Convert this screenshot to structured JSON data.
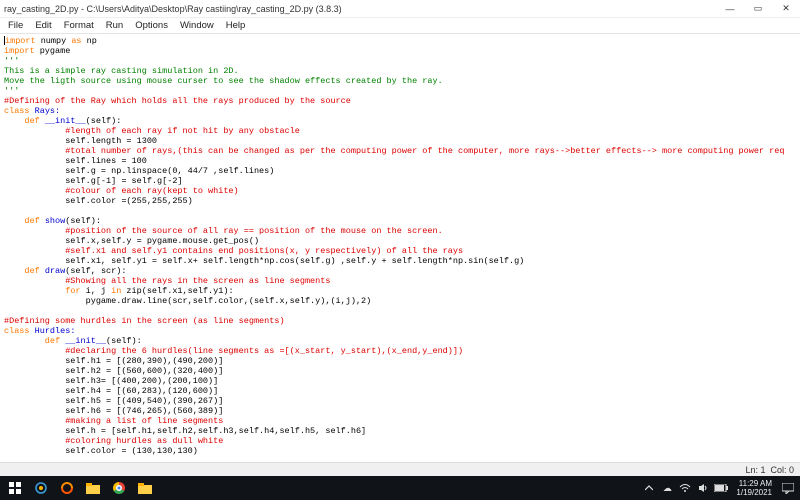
{
  "title": "ray_casting_2D.py - C:\\Users\\Aditya\\Desktop\\Ray castiing\\ray_casting_2D.py (3.8.3)",
  "menus": {
    "file": "File",
    "edit": "Edit",
    "format": "Format",
    "run": "Run",
    "options": "Options",
    "window": "Window",
    "help": "Help"
  },
  "status": {
    "ln": "Ln: 1",
    "col": "Col: 0"
  },
  "taskbar": {
    "time": "11:29 AM",
    "date": "1/19/2021"
  },
  "win": {
    "min": "—",
    "max": "▭",
    "close": "✕"
  },
  "code": {
    "l1_a": "import",
    "l1_b": " numpy ",
    "l1_c": "as",
    "l1_d": " np",
    "l2_a": "import",
    "l2_b": " pygame",
    "l3": "'''",
    "l4": "This is a simple ray casting simulation in 2D.",
    "l5": "Move the ligth source using mouse curser to see the shadow effects created by the ray.",
    "l6": "'''",
    "l7": "#Defining of the Ray which holds all the rays produced by the source",
    "l8_a": "class",
    "l8_b": " Rays:",
    "l9_a": "    def",
    "l9_b": " __init__",
    "l9_c": "(self):",
    "l10": "            #length of each ray if not hit by any obstacle",
    "l11": "            self.length = 1300",
    "l12": "            #total number of rays,(this can be changed as per the computing power of the computer, more rays-->better effects--> more computing power req",
    "l13": "            self.lines = 100",
    "l14": "            self.g = np.linspace(0, 44/7 ,self.lines)",
    "l15": "            self.g[-1] = self.g[-2]",
    "l16": "            #colour of each ray(kept to white)",
    "l17": "            self.color =(255,255,255)",
    "l18": " ",
    "l19_a": "    def",
    "l19_b": " show",
    "l19_c": "(self):",
    "l20": "            #position of the source of all ray == position of the mouse on the screen.",
    "l21": "            self.x,self.y = pygame.mouse.get_pos()",
    "l22": "            #self.x1 and self.y1 contains end positions(x, y respectively) of all the rays",
    "l23": "            self.x1, self.y1 = self.x+ self.length*np.cos(self.g) ,self.y + self.length*np.sin(self.g)",
    "l24_a": "    def",
    "l24_b": " draw",
    "l24_c": "(self, scr):",
    "l25": "            #Showing all the rays in the screen as line segments",
    "l26_a": "            for",
    "l26_b": " i, j ",
    "l26_c": "in",
    "l26_d": " zip(self.x1,self.y1):",
    "l27": "                pygame.draw.line(scr,self.color,(self.x,self.y),(i,j),2)",
    "l28": " ",
    "l29": "#Defining some hurdles in the screen (as line segments)",
    "l30_a": "class",
    "l30_b": " Hurdles:",
    "l31_a": "        def",
    "l31_b": " __init__",
    "l31_c": "(self):",
    "l32": "            #declaring the 6 hurdles(line segments as =[(x_start, y_start),(x_end,y_end)])",
    "l33": "            self.h1 = [(280,390),(490,200)]",
    "l34": "            self.h2 = [(560,600),(320,400)]",
    "l35": "            self.h3= [(400,200),(200,100)]",
    "l36": "            self.h4 = [(60,283),(120,600)]",
    "l37": "            self.h5 = [(409,540),(390,267)]",
    "l38": "            self.h6 = [(746,265),(560,389)]",
    "l39": "            #making a list of line segments",
    "l40": "            self.h = [self.h1,self.h2,self.h3,self.h4,self.h5, self.h6]",
    "l41": "            #coloring hurdles as dull white",
    "l42": "            self.color = (130,130,130)",
    "l43": " "
  }
}
